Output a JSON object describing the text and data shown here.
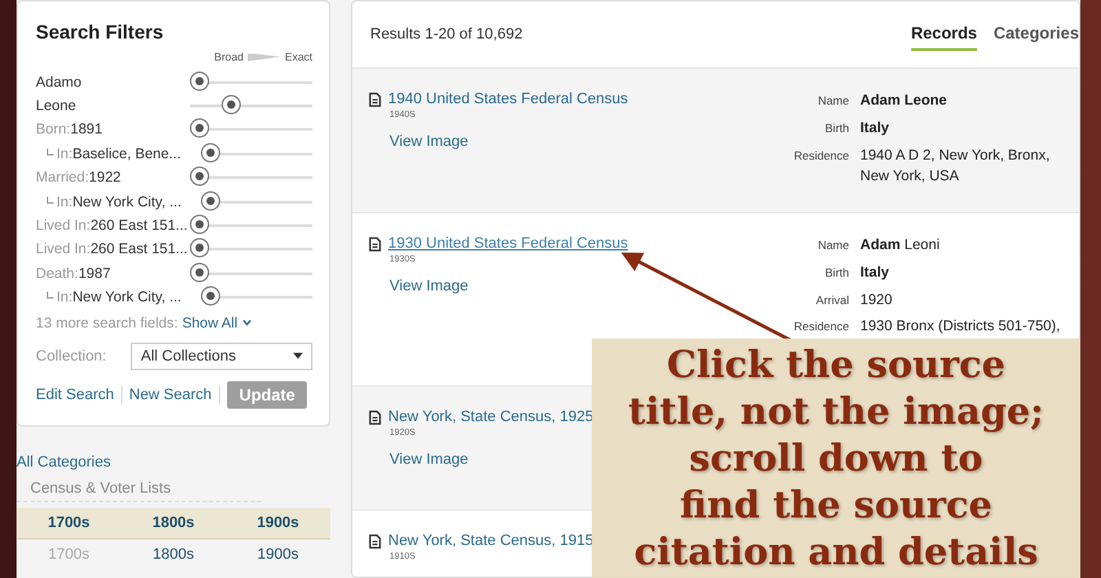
{
  "filters": {
    "title": "Search Filters",
    "scale": {
      "low": "Broad",
      "high": "Exact"
    },
    "rows": [
      {
        "label": "",
        "value": "Adamo",
        "level": 0
      },
      {
        "label": "",
        "value": "Leone",
        "level": 0.32
      },
      {
        "label": "Born:",
        "value": "1891",
        "level": 0,
        "children": [
          {
            "label": "In:",
            "value": "Baselice, Bene...",
            "level": 0
          }
        ]
      },
      {
        "label": "Married:",
        "value": "1922",
        "level": 0,
        "children": [
          {
            "label": "In:",
            "value": "New York City, ...",
            "level": 0
          }
        ]
      },
      {
        "label": "Lived In:",
        "value": "260 East 151...",
        "level": 0
      },
      {
        "label": "Lived In:",
        "value": "260 East 151...",
        "level": 0
      },
      {
        "label": "Death:",
        "value": "1987",
        "level": 0,
        "children": [
          {
            "label": "In:",
            "value": "New York City, ...",
            "level": 0
          }
        ]
      }
    ],
    "more": {
      "text": "13 more search fields:",
      "link": "Show All"
    },
    "collection": {
      "label": "Collection:",
      "value": "All Collections"
    },
    "actions": [
      {
        "label": "Edit Search",
        "kind": "link",
        "disabled": false
      },
      {
        "label": "New Search",
        "kind": "link",
        "disabled": false
      },
      {
        "label": "Update",
        "kind": "button",
        "disabled": true
      }
    ]
  },
  "categories": {
    "link": "All Categories",
    "group": "Census & Voter Lists",
    "decades": [
      {
        "kind": "header",
        "cells": [
          {
            "label": "1700s",
            "disabled": false
          },
          {
            "label": "1800s",
            "disabled": false
          },
          {
            "label": "1900s",
            "disabled": false
          }
        ]
      },
      {
        "kind": "plain",
        "cells": [
          {
            "label": "1700s",
            "disabled": true
          },
          {
            "label": "1800s",
            "disabled": false
          },
          {
            "label": "1900s",
            "disabled": false
          }
        ]
      }
    ]
  },
  "results": {
    "summary": "Results 1-20 of 10,692",
    "tabs": [
      {
        "label": "Records",
        "selected": true
      },
      {
        "label": "Categories",
        "selected": false
      }
    ],
    "records": [
      {
        "title": "1940 United States Federal Census",
        "highlighted": false,
        "decade": "1940S",
        "action": "View Image",
        "fields": [
          {
            "label": "Name",
            "value": "**Adam Leone**"
          },
          {
            "label": "Birth",
            "value": "**Italy**"
          },
          {
            "label": "Residence",
            "value": "1940 A D 2, New York, Bronx, New York, USA"
          }
        ]
      },
      {
        "title": "1930 United States Federal Census",
        "highlighted": true,
        "decade": "1930S",
        "action": "View Image",
        "fields": [
          {
            "label": "Name",
            "value": "**Adam** Leoni"
          },
          {
            "label": "Birth",
            "value": "**Italy**"
          },
          {
            "label": "Arrival",
            "value": "1920"
          },
          {
            "label": "Residence",
            "value": "1930 Bronx (Districts 501-750),"
          }
        ]
      },
      {
        "title": "New York, State Census, 1925",
        "highlighted": false,
        "decade": "1920S",
        "action": "View Image"
      },
      {
        "title": "New York, State Census, 1915",
        "highlighted": false,
        "decade": "1910S"
      }
    ]
  },
  "callout": {
    "lines": [
      "Click the source",
      "title, not the image;",
      "scroll down to",
      "find the source",
      "citation and details"
    ]
  }
}
